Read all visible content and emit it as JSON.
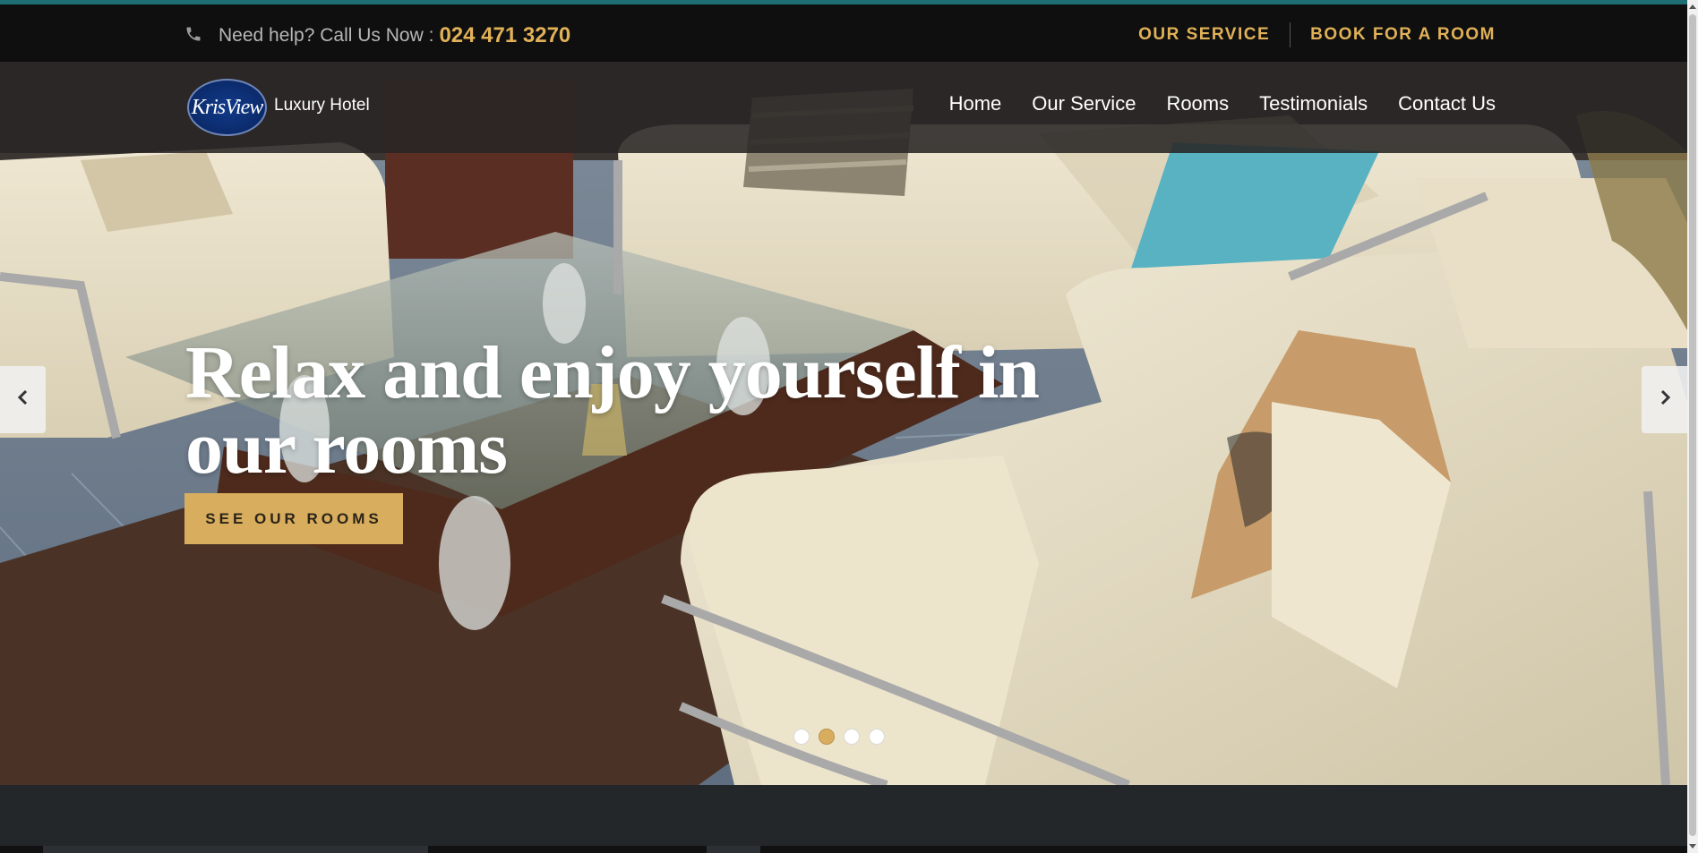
{
  "topbar": {
    "help_text": "Need help? Call Us Now :",
    "phone_number": "024 471 3270",
    "links": [
      "OUR SERVICE",
      "BOOK FOR A ROOM"
    ]
  },
  "brand": {
    "logo_text": "KrisView",
    "subtitle": "Luxury Hotel"
  },
  "nav": {
    "items": [
      "Home",
      "Our Service",
      "Rooms",
      "Testimonials",
      "Contact Us"
    ]
  },
  "hero": {
    "headline": "Relax and enjoy yourself in our rooms",
    "cta_label": "SEE OUR ROOMS",
    "slides_count": 4,
    "active_slide": 2
  },
  "icons": {
    "phone": "phone-icon",
    "prev": "chevron-left-icon",
    "next": "chevron-right-icon"
  },
  "colors": {
    "accent": "#d8ad5e",
    "topbar_bg": "#0f0f0f",
    "accent_strip": "#1d6f74"
  }
}
